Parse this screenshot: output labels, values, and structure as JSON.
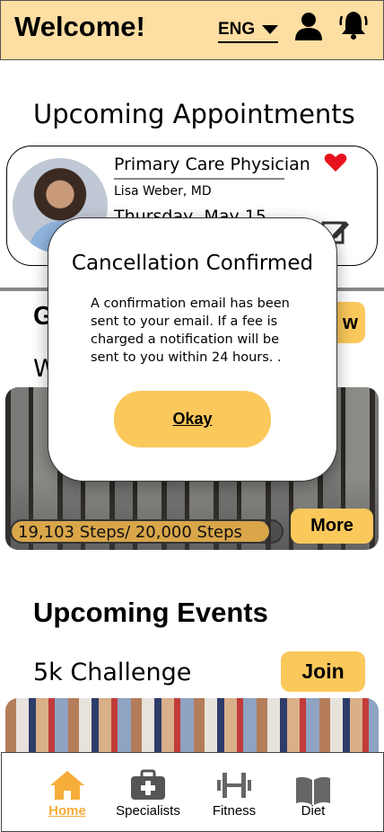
{
  "header": {
    "title": "Welcome!",
    "language": "ENG",
    "icons": [
      "user-icon",
      "bell-icon"
    ]
  },
  "appointments": {
    "heading": "Upcoming Appointments",
    "card": {
      "type": "Primary Care Physician",
      "doctor": "Lisa Weber, MD",
      "date": "Thursday, May 15"
    }
  },
  "goals": {
    "heading": "G",
    "view_label": "w",
    "walk_heading": "W",
    "progress_text": "19,103 Steps/ 20,000 Steps",
    "progress_fraction": 0.955,
    "more_label": "More"
  },
  "events": {
    "heading": "Upcoming Events",
    "event_name": "5k Challenge",
    "join_label": "Join"
  },
  "nav": {
    "items": [
      {
        "label": "Home",
        "icon": "home-icon"
      },
      {
        "label": "Specialists",
        "icon": "medkit-icon"
      },
      {
        "label": "Fitness",
        "icon": "dumbbell-icon"
      },
      {
        "label": "Diet",
        "icon": "book-icon"
      }
    ]
  },
  "modal": {
    "title": "Cancellation Confirmed",
    "body": "A confirmation email has been sent to your email. If a fee is charged a notification will be sent to you within 24 hours. .",
    "ok_label": "Okay"
  },
  "colors": {
    "header_bg": "#fddea3",
    "accent": "#fbc85b",
    "active_nav": "#f6ad3a",
    "heart": "#e8121f"
  }
}
